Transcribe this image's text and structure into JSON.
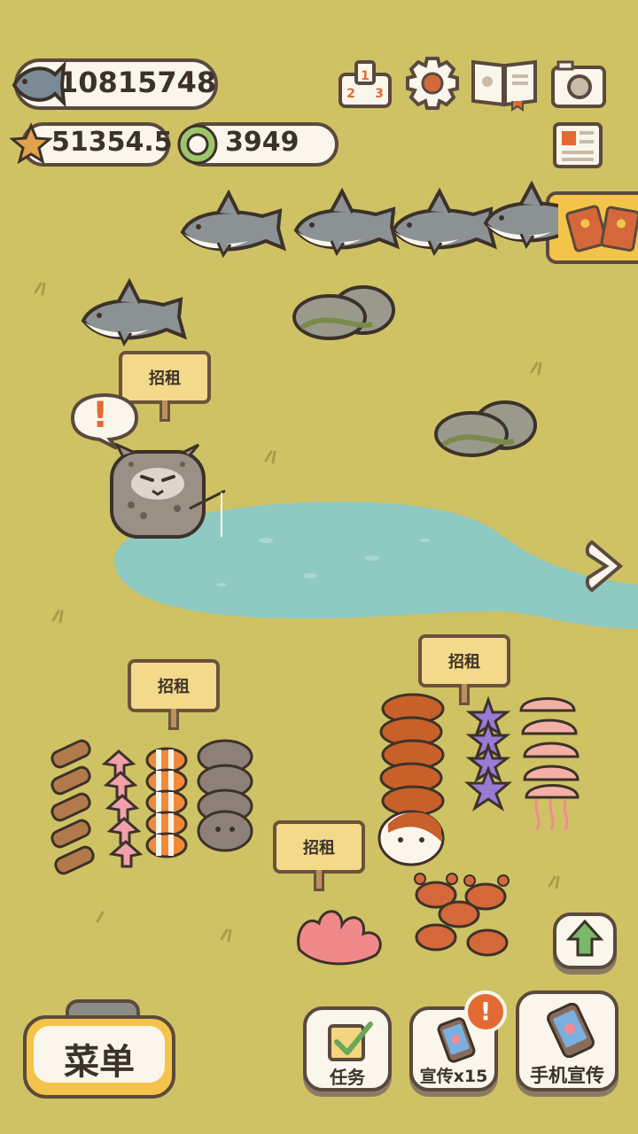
{
  "currency": {
    "fish": "10815748",
    "star": "51354.5",
    "ring": "3949"
  },
  "signs": {
    "rent_label": "招租"
  },
  "buttons": {
    "menu_label": "菜单",
    "task_label": "任务",
    "promote_label": "宣传x15",
    "phone_promote_label": "手机宣传"
  },
  "alerts": {
    "bubble": "!",
    "promote_badge": "!"
  },
  "icons": [
    "fish-icon",
    "star-icon",
    "ring-icon",
    "leaderboard-icon",
    "gear-icon",
    "book-icon",
    "camera-icon",
    "newspaper-icon",
    "envelope-icon",
    "arrow-right-icon",
    "arrow-up-icon",
    "checkbox-icon",
    "phone-icon"
  ],
  "colors": {
    "grass": "#cfc264",
    "water": "#8ec9c2",
    "outline": "#5a4a3e",
    "panel": "#fbf6ec",
    "menu_yellow": "#f4c44a",
    "alert": "#e36a32"
  }
}
